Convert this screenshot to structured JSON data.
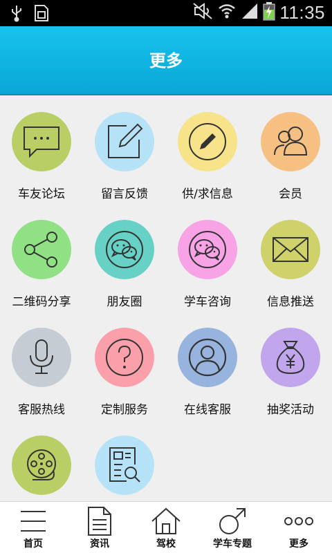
{
  "status_bar": {
    "time": "11:35",
    "icons": [
      "usb-icon",
      "sim-icon",
      "mute-icon",
      "wifi-icon",
      "signal-icon",
      "battery-charging-icon"
    ]
  },
  "header": {
    "title": "更多"
  },
  "grid": {
    "items": [
      {
        "label": "车友论坛",
        "icon": "chat-bubble-icon",
        "color": "#b9cf65"
      },
      {
        "label": "留言反馈",
        "icon": "edit-icon",
        "color": "#b6e2f7"
      },
      {
        "label": "供/求信息",
        "icon": "pencil-icon",
        "color": "#f6e38a"
      },
      {
        "label": "会员",
        "icon": "members-icon",
        "color": "#f6c083"
      },
      {
        "label": "二维码分享",
        "icon": "share-icon",
        "color": "#8fe184"
      },
      {
        "label": "朋友圈",
        "icon": "wechat-icon",
        "color": "#67d1c5"
      },
      {
        "label": "学车咨询",
        "icon": "wechat-icon",
        "color": "#f7a3e6"
      },
      {
        "label": "信息推送",
        "icon": "mail-icon",
        "color": "#cfd26a"
      },
      {
        "label": "客服热线",
        "icon": "microphone-icon",
        "color": "#c6ccd3"
      },
      {
        "label": "定制服务",
        "icon": "question-icon",
        "color": "#fba0aa"
      },
      {
        "label": "在线客服",
        "icon": "user-icon",
        "color": "#96b4dd"
      },
      {
        "label": "抽奖活动",
        "icon": "money-bag-icon",
        "color": "#c2a6ed"
      },
      {
        "label": "",
        "icon": "film-reel-icon",
        "color": "#b9cf65"
      },
      {
        "label": "",
        "icon": "search-document-icon",
        "color": "#b6e2f7"
      }
    ]
  },
  "bottom_nav": {
    "items": [
      {
        "label": "首页",
        "icon": "menu-icon"
      },
      {
        "label": "资讯",
        "icon": "document-icon"
      },
      {
        "label": "驾校",
        "icon": "home-icon"
      },
      {
        "label": "学车专题",
        "icon": "male-icon"
      },
      {
        "label": "更多",
        "icon": "more-icon"
      }
    ]
  }
}
